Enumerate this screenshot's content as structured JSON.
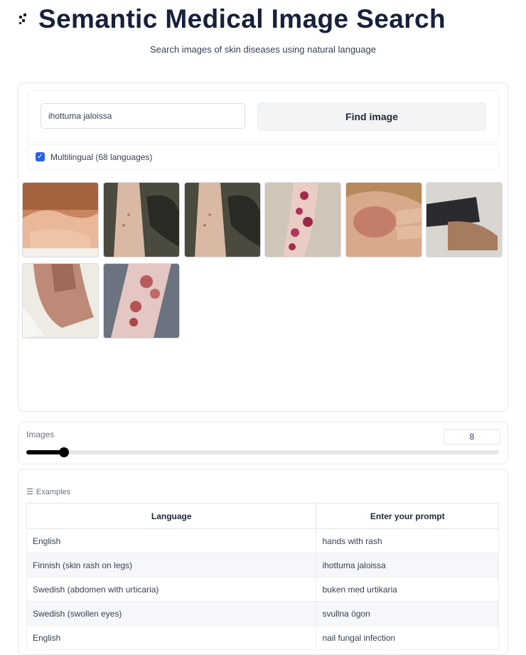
{
  "header": {
    "title": "Semantic Medical Image Search",
    "subtitle": "Search images of skin diseases using natural language"
  },
  "search": {
    "query_value": "ihottuma jaloissa",
    "button_label": "Find image"
  },
  "multilingual": {
    "label": "Multilingual (68 languages)",
    "checked": true
  },
  "gallery": {
    "images": [
      {
        "name": "gallery-image-1",
        "icon": "skin-lesion-foot-photo"
      },
      {
        "name": "gallery-image-2",
        "icon": "rash-on-legs-photo"
      },
      {
        "name": "gallery-image-3",
        "icon": "rash-on-legs-photo"
      },
      {
        "name": "gallery-image-4",
        "icon": "red-lesions-foot-photo"
      },
      {
        "name": "gallery-image-5",
        "icon": "rash-on-foot-photo"
      },
      {
        "name": "gallery-image-6",
        "icon": "ankle-photo"
      },
      {
        "name": "gallery-image-7",
        "icon": "swollen-leg-photo"
      },
      {
        "name": "gallery-image-8",
        "icon": "lesions-on-leg-photo"
      }
    ]
  },
  "images_control": {
    "label": "Images",
    "value": "8",
    "slider_fraction": 0.08
  },
  "examples": {
    "label": "Examples",
    "columns": [
      "Language",
      "Enter your prompt"
    ],
    "rows": [
      [
        "English",
        "hands with rash"
      ],
      [
        "Finnish (skin rash on legs)",
        "ihottuma jaloissa"
      ],
      [
        "Swedish (abdomen with urticaria)",
        "buken med urtikaria"
      ],
      [
        "Swedish (swollen eyes)",
        "svullna ögon"
      ],
      [
        "English",
        "nail fungal infection"
      ]
    ]
  },
  "colors": {
    "accent": "#2563eb",
    "title": "#17213a",
    "slider": "#000000"
  }
}
